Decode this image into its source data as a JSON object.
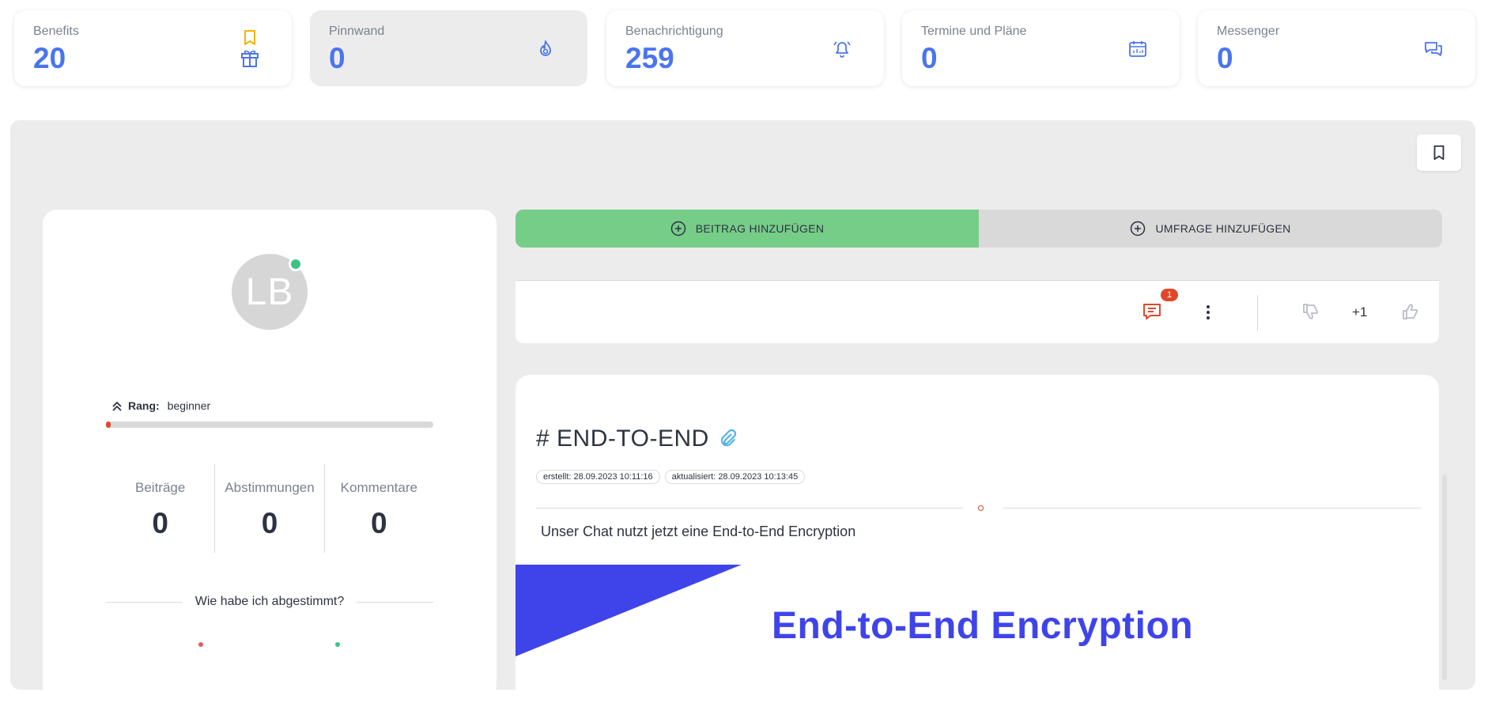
{
  "stats": [
    {
      "label": "Benefits",
      "value": "20"
    },
    {
      "label": "Pinnwand",
      "value": "0"
    },
    {
      "label": "Benachrichtigung",
      "value": "259"
    },
    {
      "label": "Termine und Pläne",
      "value": "0"
    },
    {
      "label": "Messenger",
      "value": "0"
    }
  ],
  "profile": {
    "initials": "LB",
    "rank_label": "Rang:",
    "rank_value": "beginner",
    "rank_progress": 0.01,
    "stats": [
      {
        "label": "Beiträge",
        "value": "0"
      },
      {
        "label": "Abstimmungen",
        "value": "0"
      },
      {
        "label": "Kommentare",
        "value": "0"
      }
    ],
    "vote_heading": "Wie habe ich abgestimmt?"
  },
  "actions": {
    "add_post": "BEITRAG HINZUFÜGEN",
    "add_poll": "UMFRAGE HINZUFÜGEN"
  },
  "feed_item": {
    "comment_count": "1",
    "score": "+1"
  },
  "post": {
    "title": "# END-TO-END",
    "created": "erstellt: 28.09.2023 10:11:16",
    "updated": "aktualisiert: 28.09.2023 10:13:45",
    "body": "Unser Chat nutzt jetzt eine End-to-End Encryption",
    "image_title": "End-to-End Encryption"
  },
  "colors": {
    "accent_blue": "#4a74f0",
    "green": "#76cd88",
    "red": "#e0482b",
    "image_blue": "#3f44ea",
    "icon_yellow": "#f4b400"
  }
}
